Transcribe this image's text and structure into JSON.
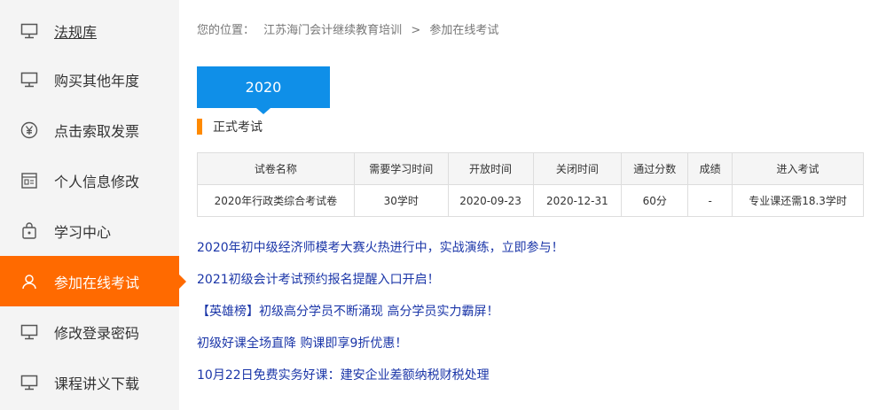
{
  "sidebar": {
    "items": [
      {
        "label": "法规库",
        "icon": "monitor-icon"
      },
      {
        "label": "购买其他年度",
        "icon": "monitor-icon"
      },
      {
        "label": "点击索取发票",
        "icon": "yen-circle-icon"
      },
      {
        "label": "个人信息修改",
        "icon": "id-card-icon"
      },
      {
        "label": "学习中心",
        "icon": "bag-icon"
      },
      {
        "label": "参加在线考试",
        "icon": "user-icon",
        "active": true
      },
      {
        "label": "修改登录密码",
        "icon": "monitor-icon"
      },
      {
        "label": "课程讲义下载",
        "icon": "monitor-icon"
      }
    ]
  },
  "breadcrumb": {
    "prefix": "您的位置：",
    "site": "江苏海门会计继续教育培训",
    "sep": ">",
    "current": "参加在线考试"
  },
  "year_tab": "2020",
  "section_title": "正式考试",
  "table": {
    "headers": [
      "试卷名称",
      "需要学习时间",
      "开放时间",
      "关闭时间",
      "通过分数",
      "成绩",
      "进入考试"
    ],
    "rows": [
      [
        "2020年行政类综合考试卷",
        "30学时",
        "2020-09-23",
        "2020-12-31",
        "60分",
        "-",
        "专业课还需18.3学时"
      ]
    ]
  },
  "news": [
    "2020年初中级经济师模考大赛火热进行中，实战演练，立即参与！",
    "2021初级会计考试预约报名提醒入口开启！",
    "【英雄榜】初级高分学员不断涌现 高分学员实力霸屏！",
    "初级好课全场直降 购课即享9折优惠！",
    "10月22日免费实务好课：建安企业差额纳税财税处理"
  ],
  "colors": {
    "accent_orange": "#ff6a00",
    "tab_blue": "#0f8fe8",
    "link_blue": "#1b36a8",
    "sidebar_bg": "#f4f4f4"
  }
}
